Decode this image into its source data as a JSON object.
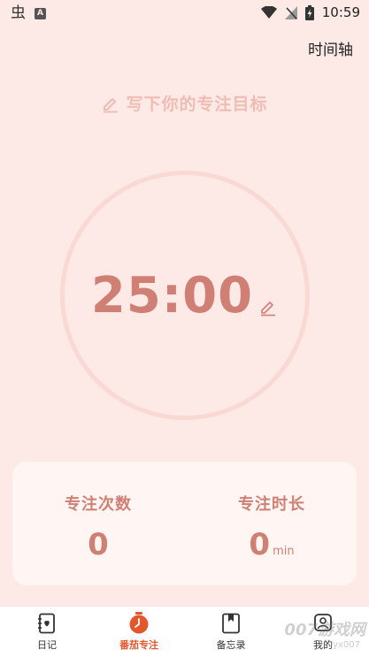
{
  "status_bar": {
    "time": "10:59",
    "app_glyph": "虫",
    "notification_letter": "A"
  },
  "header": {
    "timeline_label": "时间轴"
  },
  "goal": {
    "placeholder": "写下你的专注目标"
  },
  "timer": {
    "value": "25:00"
  },
  "stats": {
    "count_label": "专注次数",
    "count_value": "0",
    "duration_label": "专注时长",
    "duration_value": "0",
    "duration_unit": "min"
  },
  "bottom_nav": {
    "items": [
      {
        "label": "日记",
        "icon": "diary-icon"
      },
      {
        "label": "番茄专注",
        "icon": "tomato-timer-icon",
        "active": true
      },
      {
        "label": "备忘录",
        "icon": "memo-icon"
      },
      {
        "label": "我的",
        "icon": "profile-icon"
      }
    ]
  },
  "watermark": {
    "text": "007游戏网",
    "url": "yx007"
  },
  "colors": {
    "background": "#fde9e6",
    "accent": "#cf7f73",
    "active_nav": "#e2582e",
    "ring": "#f9d9d3"
  }
}
